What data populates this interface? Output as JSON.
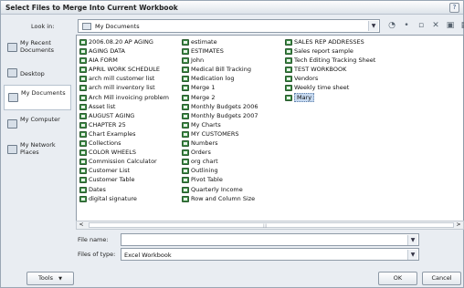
{
  "window": {
    "title": "Select Files to Merge Into Current Workbook",
    "help_glyph": "?"
  },
  "look_in": {
    "label": "Look in:",
    "value": "My Documents"
  },
  "toolbar": {
    "glyphs": [
      "◔",
      "•",
      "▫",
      "✕",
      "▣",
      "▦"
    ]
  },
  "places": [
    {
      "label": "My Recent Documents",
      "icon": "clock-folder-icon"
    },
    {
      "label": "Desktop",
      "icon": "desktop-icon"
    },
    {
      "label": "My Documents",
      "icon": "documents-folder-icon",
      "selected": true
    },
    {
      "label": "My Computer",
      "icon": "computer-icon"
    },
    {
      "label": "My Network Places",
      "icon": "network-icon"
    }
  ],
  "files": {
    "column1": [
      "2006.08.20 AP AGING",
      "AGING DATA",
      "AIA FORM",
      "APRIL WORK SCHEDULE",
      "arch mill customer list",
      "arch mill inventory list",
      "Arch Mill invoicing problem",
      "Asset list",
      "AUGUST AGING",
      "CHAPTER 25",
      "Chart Examples",
      "Collections",
      "COLOR WHEELS",
      "Commission Calculator",
      "Customer List",
      "Customer Table",
      "Dates",
      "digital signature"
    ],
    "column2": [
      "estimate",
      "ESTIMATES",
      "John",
      "Medical Bill Tracking",
      "Medication log",
      "Merge 1",
      "Merge 2",
      "Monthly Budgets 2006",
      "Monthly Budgets 2007",
      "My Charts",
      "MY CUSTOMERS",
      "Numbers",
      "Orders",
      "org chart",
      "Outlining",
      "Pivot Table",
      "Quarterly Income",
      "Row and Column Size"
    ],
    "column3": [
      "SALES REP ADDRESSES",
      "Sales report sample",
      "Tech Editing Tracking Sheet",
      "TEST WORKBOOK",
      "Vendors",
      "Weekly time sheet",
      "Mary"
    ],
    "selected": "Mary",
    "icon": "excel-file-icon"
  },
  "scrollbar": {
    "left_glyph": "<",
    "right_glyph": ">",
    "grip": "|||"
  },
  "file_name": {
    "label": "File name:",
    "value": ""
  },
  "file_type": {
    "label": "Files of type:",
    "value": "Excel Workbook"
  },
  "buttons": {
    "tools": "Tools",
    "ok": "OK",
    "cancel": "Cancel"
  },
  "dropdown_glyph": "▼"
}
